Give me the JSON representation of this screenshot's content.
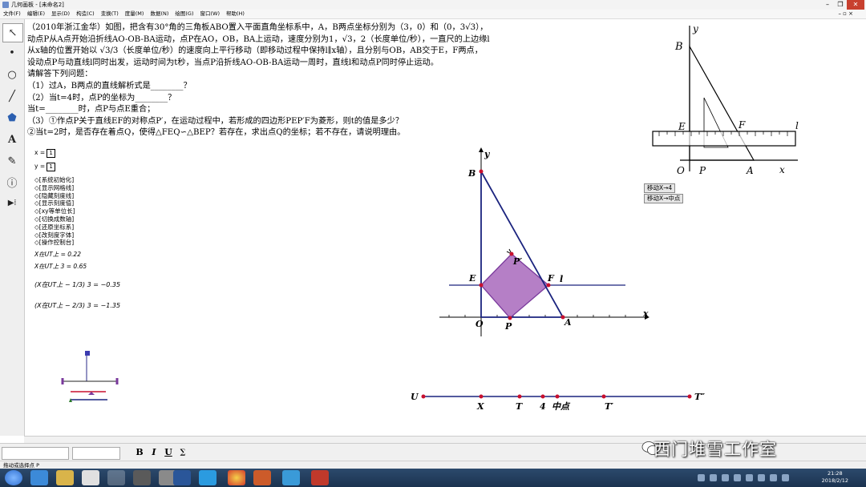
{
  "window": {
    "title": "几何画板 - [未命名2]",
    "controls": {
      "minimize": "–",
      "restore": "❐",
      "close": "✕"
    },
    "menu": [
      "文件(F)",
      "编辑(E)",
      "显示(D)",
      "构造(C)",
      "变换(T)",
      "度量(M)",
      "数据(N)",
      "绘图(G)",
      "窗口(W)",
      "帮助(H)"
    ],
    "doc_controls": "– ▫ ×"
  },
  "tools": [
    {
      "icon": "selection-arrow-icon",
      "glyph": "↖"
    },
    {
      "icon": "point-tool-icon",
      "glyph": "•"
    },
    {
      "icon": "compass-tool-icon",
      "glyph": "○"
    },
    {
      "icon": "straightedge-tool-icon",
      "glyph": "╱"
    },
    {
      "icon": "polygon-tool-icon",
      "glyph": "⬟"
    },
    {
      "icon": "text-tool-icon",
      "glyph": "A"
    },
    {
      "icon": "marker-tool-icon",
      "glyph": "✎"
    },
    {
      "icon": "information-tool-icon",
      "glyph": "ⓘ"
    },
    {
      "icon": "custom-tool-icon",
      "glyph": "▶⁞"
    }
  ],
  "problem": {
    "lines": [
      "（2010年浙江金华）如图，把含有30°角的三角板ABO置入平面直角坐标系中，A，B两点坐标分别为（3，0）和（0，3√3），",
      "动点P从A点开始沿折线AO-OB-BA运动，点P在AO，OB，BA上运动，速度分别为1，√3，2（长度单位/秒），一直尺的上边缘l",
      "从x轴的位置开始以 √3/3（长度单位/秒）的速度向上平行移动（即移动过程中保持l∥x轴），且分别与OB，AB交于E，F两点，",
      "设动点P与动直线l同时出发，运动时间为t秒，当点P沿折线AO-OB-BA运动一周时，直线l和动点P同时停止运动。",
      "请解答下列问题：",
      "（1）过A，B两点的直线解析式是________？",
      "（2）当t=4时，点P的坐标为________？",
      "      当t=________时，点P与点E重合；",
      "（3）①作点P关于直线EF的对称点P′，在运动过程中，若形成的四边形PEP′F为菱形，则t的值是多少？",
      "      ②当t=2时，是否存在着点Q，使得△FEQ∽△BEP？若存在，求出点Q的坐标；若不存在，请说明理由。"
    ]
  },
  "params": {
    "x_label": "x =",
    "x_value": "1",
    "y_label": "y =",
    "y_value": "1"
  },
  "action_buttons": [
    "◇[系统初始化]",
    "◇[显示网格线]",
    "◇[隐藏刻度线]",
    "◇[显示刻度值]",
    "◇[xy等单位长]",
    "◇[切换成数轴]",
    "◇[还原坐标系]",
    "◇[改刻度字体]",
    "◇[操作控制台]"
  ],
  "measurements": {
    "m1": "X在UT上 = 0.22",
    "m2": "X在UT上 3 = 0.65",
    "m3": "(X在UT上 − 1/3) 3 = −0.35",
    "m4": "(X在UT上 − 2/3) 3 = −1.35"
  },
  "reference_figure": {
    "labels": {
      "B": "B",
      "y": "y",
      "E": "E",
      "F": "F",
      "l": "l",
      "O": "O",
      "P": "P",
      "A": "A",
      "x": "x"
    }
  },
  "move_buttons": [
    "移动X→4",
    "移动X→中点"
  ],
  "main_figure": {
    "labels": {
      "B": "B",
      "y": "y",
      "E": "E",
      "F": "F",
      "l": "l",
      "Pprime": "P′",
      "O": "O",
      "P": "P",
      "A": "A",
      "x": "x"
    }
  },
  "number_line": {
    "labels": {
      "U": "U",
      "X": "X",
      "T": "T",
      "four": "4",
      "mid": "中点",
      "Tprime": "T′",
      "Tdouble": "T″"
    }
  },
  "format_bar": {
    "bold": "B",
    "italic": "I",
    "underline": "U",
    "symbol": "∑"
  },
  "status": "拖动或选择点 P",
  "clock": {
    "time": "21:28",
    "date": "2018/2/12"
  },
  "watermark": "西门堆雪工作室",
  "colors": {
    "rhombus_fill": "#b57fc6",
    "rhombus_stroke": "#7a3a9c",
    "point_red": "#c8102e",
    "line_navy": "#1a237e",
    "taskbar": "#1f3a5c"
  }
}
